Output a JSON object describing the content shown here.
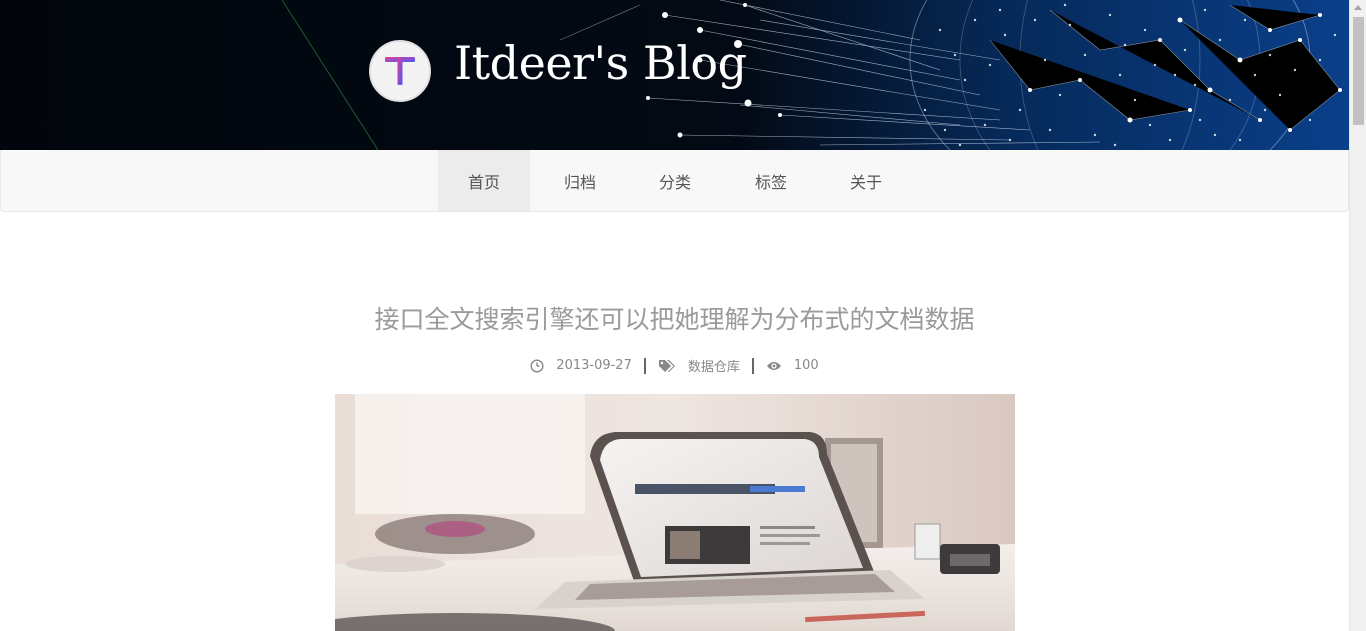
{
  "site": {
    "logo_letter": "T",
    "title": "Itdeer's Blog"
  },
  "nav": {
    "items": [
      {
        "label": "首页",
        "active": true
      },
      {
        "label": "归档",
        "active": false
      },
      {
        "label": "分类",
        "active": false
      },
      {
        "label": "标签",
        "active": false
      },
      {
        "label": "关于",
        "active": false
      }
    ]
  },
  "post": {
    "title": "接口全文搜索引擎还可以把她理解为分布式的文档数据",
    "date": "2013-09-27",
    "category": "数据仓库",
    "views": "100",
    "icons": {
      "date": "clock-icon",
      "category": "tags-icon",
      "views": "eye-icon"
    },
    "image_alt": "laptop-on-desk"
  },
  "colors": {
    "header_dark": "#02060c",
    "header_blue": "#0a3f8a",
    "nav_bg": "#f8f8f8",
    "nav_active_bg": "#ececec",
    "title_gray": "#9a9a9a"
  }
}
